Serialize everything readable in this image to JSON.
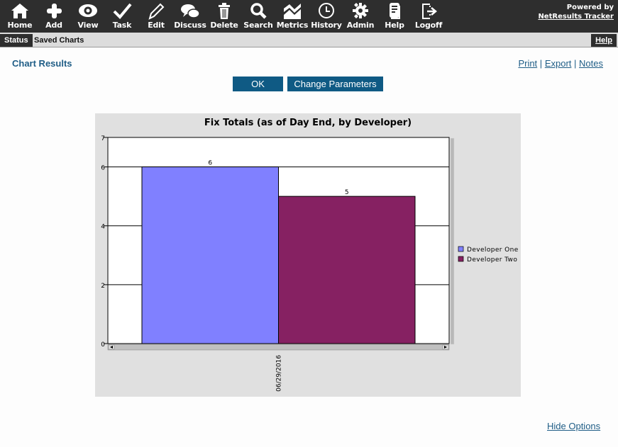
{
  "nav": {
    "items": [
      {
        "label": "Home",
        "icon": "home-icon"
      },
      {
        "label": "Add",
        "icon": "plus-icon"
      },
      {
        "label": "View",
        "icon": "eye-icon"
      },
      {
        "label": "Task",
        "icon": "checkmark-icon"
      },
      {
        "label": "Edit",
        "icon": "pencil-icon"
      },
      {
        "label": "Discuss",
        "icon": "speech-bubbles-icon"
      },
      {
        "label": "Delete",
        "icon": "trash-icon"
      },
      {
        "label": "Search",
        "icon": "magnifier-icon"
      },
      {
        "label": "Metrics",
        "icon": "metrics-icon"
      },
      {
        "label": "History",
        "icon": "clock-icon"
      },
      {
        "label": "Admin",
        "icon": "gear-icon"
      },
      {
        "label": "Help",
        "icon": "document-icon"
      },
      {
        "label": "Logoff",
        "icon": "logoff-icon"
      }
    ],
    "powered_line1": "Powered by",
    "powered_line2": "NetResults Tracker"
  },
  "subbar": {
    "status": "Status",
    "saved": "Saved Charts",
    "help": "Help"
  },
  "page": {
    "title": "Chart Results",
    "links": [
      "Print",
      "Export",
      "Notes"
    ],
    "separator": "|",
    "ok_label": "OK",
    "change_label": "Change Parameters",
    "hide_options": "Hide Options"
  },
  "chart_data": {
    "type": "bar",
    "title": "Fix Totals (as of Day End, by Developer)",
    "categories": [
      "06/29/2016"
    ],
    "series": [
      {
        "name": "Developer One",
        "values": [
          6
        ],
        "color": "#8080ff"
      },
      {
        "name": "Developer Two",
        "values": [
          5
        ],
        "color": "#862162"
      }
    ],
    "xlabel": "",
    "ylabel": "",
    "ylim": [
      0,
      7
    ],
    "yticks": [
      0,
      2,
      4,
      6,
      7
    ],
    "grid": true,
    "legend": "right"
  }
}
